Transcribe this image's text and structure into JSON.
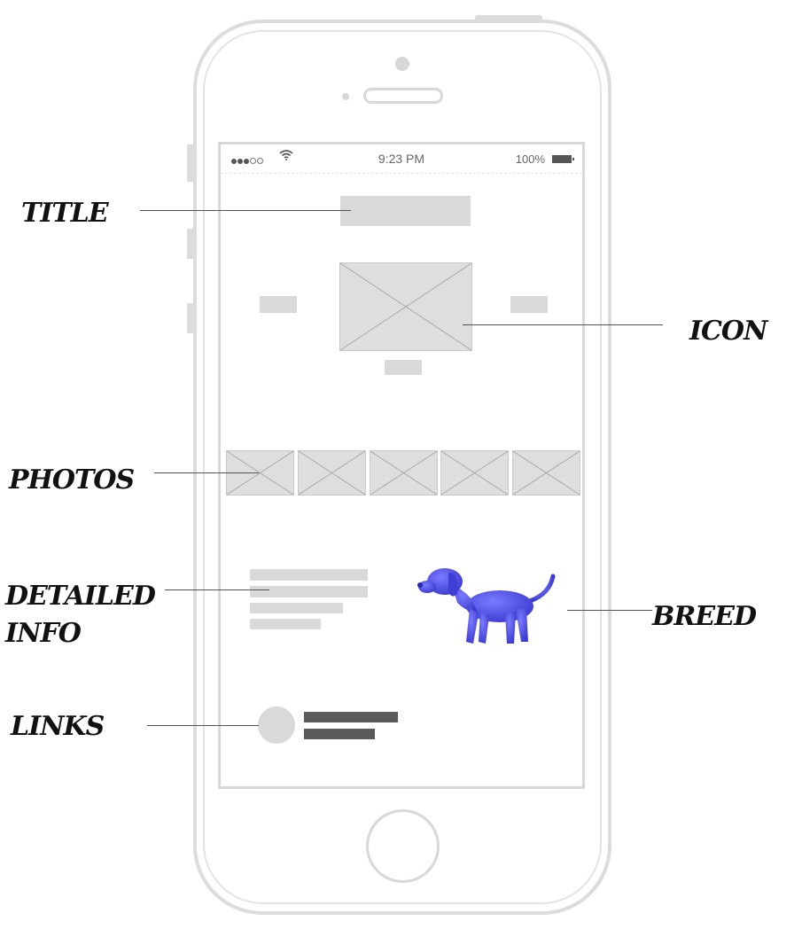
{
  "status_bar": {
    "time": "9:23 PM",
    "battery": "100%"
  },
  "callouts": {
    "title": "TITLE",
    "icon": "ICON",
    "photos": "PHOTOS",
    "detailed_info_line1": "DETAILED",
    "detailed_info_line2": "INFO",
    "breed": "BREED",
    "links": "LINKS"
  },
  "icons": {
    "wifi": "wifi-icon",
    "battery": "battery-icon",
    "dog": "dog-icon",
    "placeholder_image": "image-placeholder-icon"
  },
  "colors": {
    "dog": "#5656e6",
    "placeholder": "#d9d9d9",
    "link_bar": "#5a5a5a",
    "phone_outline": "#dcdcdc"
  }
}
